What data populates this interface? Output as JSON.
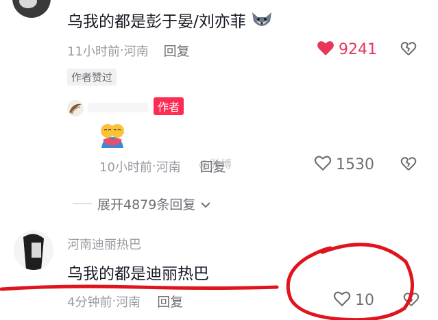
{
  "comment1": {
    "text": "乌我的都是彭于晏/刘亦菲",
    "emoji": "wolf-face-emoji",
    "time": "11小时前",
    "location": "河南",
    "reply_label": "回复",
    "like_count": "9241",
    "liked": true,
    "badge": "作者赞过"
  },
  "author_reply": {
    "author_tag": "作者",
    "sticker": "hug-emoji",
    "time": "10小时前",
    "location": "河南",
    "reply_label": "回复",
    "like_count": "1530",
    "watermark": "@微博"
  },
  "expand_replies": {
    "label": "展开4879条回复"
  },
  "comment2": {
    "username": "河南迪丽热巴",
    "text": "乌我的都是迪丽热巴",
    "time": "4分钟前",
    "location": "河南",
    "reply_label": "回复",
    "like_count": "10"
  },
  "separator": " · ",
  "colors": {
    "like_red": "#e8355a",
    "author_tag": "#fe2c55",
    "annotation_red": "#e0141c"
  }
}
